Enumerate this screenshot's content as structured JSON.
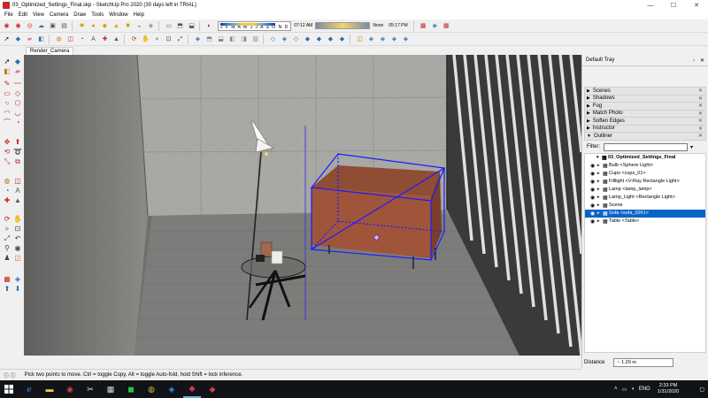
{
  "window": {
    "title": "03_Optimized_Settings_Final.skp - SketchUp Pro 2020 (30 days left in TRIAL)",
    "controls": [
      "—",
      "☐",
      "✕"
    ]
  },
  "menu": [
    "File",
    "Edit",
    "View",
    "Camera",
    "Draw",
    "Tools",
    "Window",
    "Help"
  ],
  "shadow_settings": {
    "months": "J F M A M J J A S O N D",
    "time_start": "07:12 AM",
    "time_mid": "Noon",
    "time_end": "05:17 PM"
  },
  "tabs": [
    {
      "label": "Render_Camera"
    }
  ],
  "tray": {
    "title": "Default Tray",
    "controls": [
      "▫",
      "✕"
    ],
    "panels": [
      {
        "label": "Scenes",
        "arrow": "▶"
      },
      {
        "label": "Shadows",
        "arrow": "▶"
      },
      {
        "label": "Fog",
        "arrow": "▶"
      },
      {
        "label": "Match Photo",
        "arrow": "▶"
      },
      {
        "label": "Soften Edges",
        "arrow": "▶"
      },
      {
        "label": "Instructor",
        "arrow": "▶"
      },
      {
        "label": "Outliner",
        "arrow": "▼"
      }
    ],
    "close_glyph": "✕",
    "filter_label": "Filter:",
    "outliner": {
      "root": "03_Optimized_Settings_Final",
      "items": [
        {
          "label": "Bulb <Sphere Light>",
          "selected": false
        },
        {
          "label": "Cups <cups_01>",
          "selected": false
        },
        {
          "label": "Filllight <V-Ray Rectangle Light>",
          "selected": false
        },
        {
          "label": "Lamp <lamp_lamp>",
          "selected": false
        },
        {
          "label": "Lamp_Light <Rectangle Light>",
          "selected": false
        },
        {
          "label": "Scene",
          "selected": false
        },
        {
          "label": "Sofa <sofa_02#1>",
          "selected": true
        },
        {
          "label": "Table <Table>",
          "selected": false
        }
      ]
    }
  },
  "measurements": {
    "label": "Distance",
    "value": "~ 1.29 m"
  },
  "status": {
    "text": "Pick two points to move.  Ctrl = toggle Copy, Alt = toggle Auto-fold, hold Shift = lock inference."
  },
  "taskbar": {
    "time": "2:33 PM",
    "date": "1/31/2020",
    "lang": "ENG"
  },
  "icons": {
    "accent": "#0a64c8",
    "selection_box": "#1c1cff",
    "sofa_color": "#a0543a"
  }
}
